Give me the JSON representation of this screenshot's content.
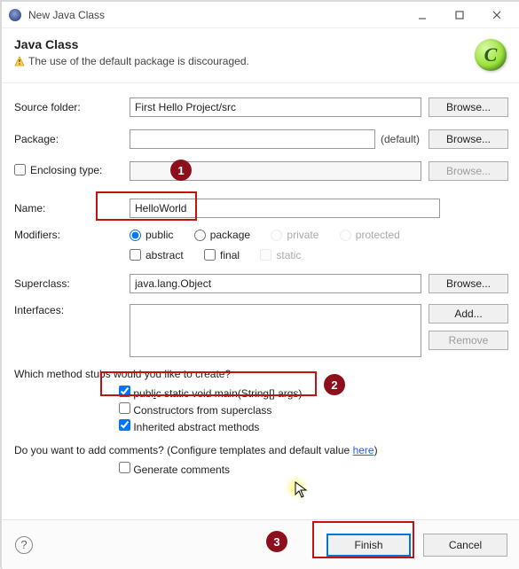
{
  "window": {
    "title": "New Java Class"
  },
  "header": {
    "heading": "Java Class",
    "warning": "The use of the default package is discouraged.",
    "glyph": "C"
  },
  "labels": {
    "source_folder": "Source folder:",
    "package": "Package:",
    "enclosing_type": "Enclosing type:",
    "name": "Name:",
    "modifiers": "Modifiers:",
    "superclass": "Superclass:",
    "interfaces": "Interfaces:"
  },
  "fields": {
    "source_folder": "First Hello Project/src",
    "package": "",
    "package_default": "(default)",
    "enclosing_type": "",
    "name": "HelloWorld",
    "superclass": "java.lang.Object"
  },
  "buttons": {
    "browse": "Browse...",
    "add": "Add...",
    "remove": "Remove",
    "finish": "Finish",
    "cancel": "Cancel"
  },
  "modifiers": {
    "public": "public",
    "package": "package",
    "private": "private",
    "protected": "protected",
    "abstract": "abstract",
    "final": "final",
    "static": "static"
  },
  "stub_question": "Which method stubs would you like to create?",
  "stubs": {
    "main": "public static void main(String[] args)",
    "constructors": "Constructors from superclass",
    "inherited": "Inherited abstract methods"
  },
  "comments": {
    "question_prefix": "Do you want to add comments? (Configure templates and default value ",
    "link": "here",
    "question_suffix": ")",
    "generate": "Generate comments"
  },
  "annotations": {
    "n1": "1",
    "n2": "2",
    "n3": "3"
  }
}
